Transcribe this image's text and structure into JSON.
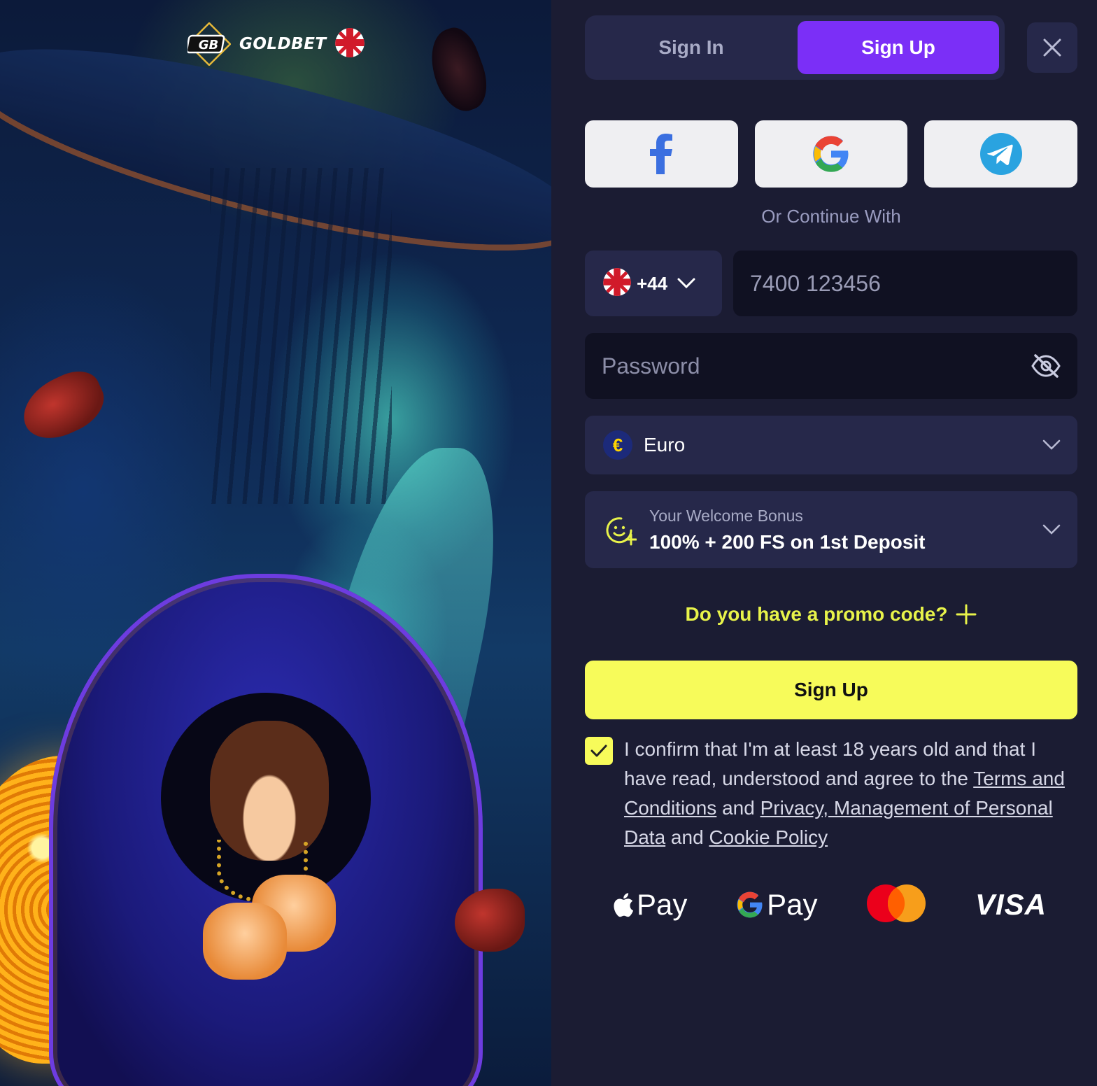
{
  "brand": {
    "name": "GOLDBET",
    "logo_mark": "GB"
  },
  "tabs": {
    "sign_in": "Sign In",
    "sign_up": "Sign Up",
    "active": "sign_up"
  },
  "close_icon": "close-icon",
  "socials": [
    "facebook-icon",
    "google-icon",
    "telegram-icon"
  ],
  "or_continue": "Or Continue With",
  "phone": {
    "country_code": "+44",
    "placeholder": "7400 123456"
  },
  "password": {
    "placeholder": "Password"
  },
  "currency": {
    "symbol": "€",
    "name": "Euro"
  },
  "bonus": {
    "label": "Your Welcome Bonus",
    "value": "100% + 200 FS on 1st Deposit"
  },
  "promo": {
    "label": "Do you have a promo code?"
  },
  "submit_label": "Sign Up",
  "consent": {
    "checked": true,
    "text_1": "I confirm that I'm at least 18 years old and that I have read, understood and agree to the ",
    "link_terms": "Terms and Conditions",
    "text_2": " and ",
    "link_privacy": "Privacy, Management of Personal Data",
    "text_3": " and ",
    "link_cookie": "Cookie Policy"
  },
  "payments": {
    "apple_pay": "Pay",
    "google_pay": "Pay",
    "mastercard": "mastercard-icon",
    "visa": "VISA"
  },
  "colors": {
    "accent_purple": "#7b2ff7",
    "accent_yellow": "#f7fb5a",
    "panel_bg": "#1b1c33",
    "field_bg": "#26284a"
  }
}
